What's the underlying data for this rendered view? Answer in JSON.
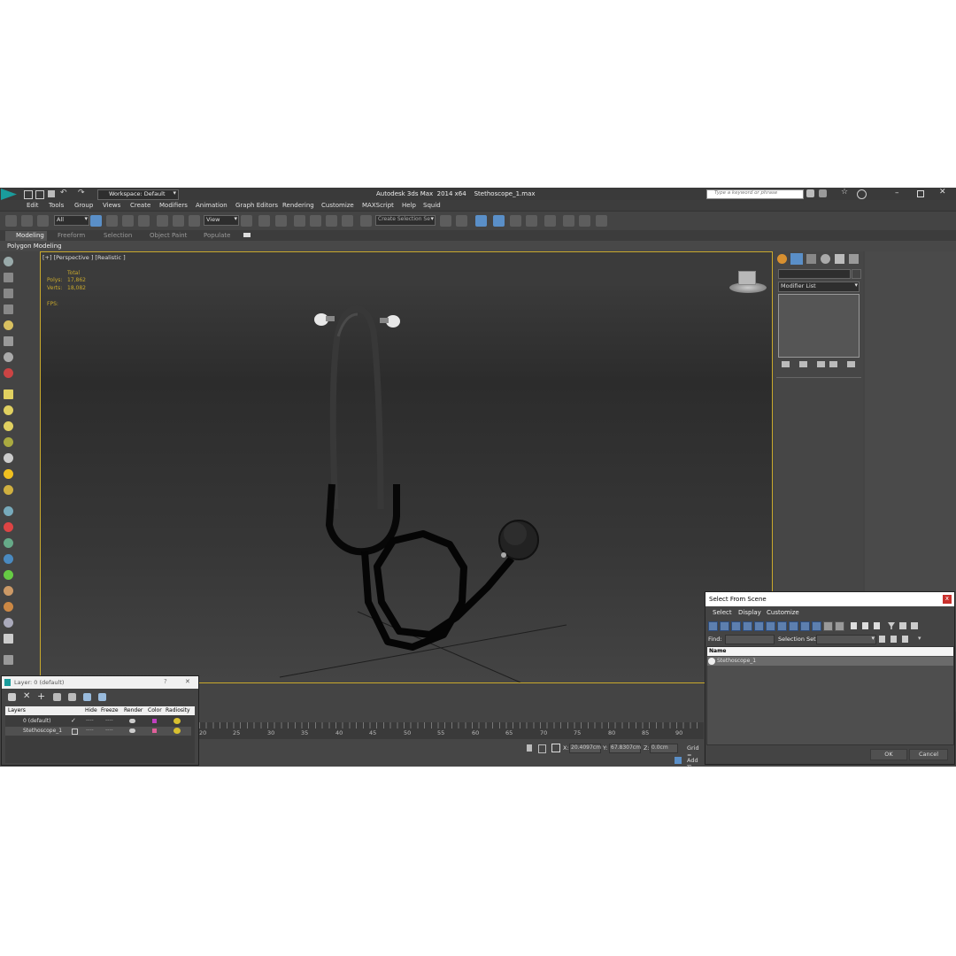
{
  "window": {
    "title": "Autodesk 3ds Max  2014 x64    Stethoscope_1.max",
    "workspace": "Workspace: Default",
    "search_placeholder": "Type a keyword or phrase"
  },
  "menu": [
    "Edit",
    "Tools",
    "Group",
    "Views",
    "Create",
    "Modifiers",
    "Animation",
    "Graph Editors",
    "Rendering",
    "Customize",
    "MAXScript",
    "Help",
    "Squid"
  ],
  "toolbar": {
    "filter_value": "All",
    "ref_coord_value": "View",
    "selection_set_placeholder": "Create Selection Se"
  },
  "ribbon": {
    "tabs": [
      "Modeling",
      "Freeform",
      "Selection",
      "Object Paint",
      "Populate"
    ],
    "sub_label": "Polygon Modeling"
  },
  "viewport": {
    "label": "[+] [Perspective ] [Realistic ]",
    "stats_total": "Total",
    "polys_label": "Polys:",
    "polys_value": "17,862",
    "verts_label": "Verts:",
    "verts_value": "18,082",
    "fps_label": "FPS:"
  },
  "command_panel": {
    "modifier_list": "Modifier List"
  },
  "timeline": {
    "ticks": [
      "20",
      "25",
      "30",
      "35",
      "40",
      "45",
      "50",
      "55",
      "60",
      "65",
      "70",
      "75",
      "80",
      "85",
      "90"
    ]
  },
  "status": {
    "x_label": "X:",
    "x_value": "20.4097cm",
    "y_label": "Y:",
    "y_value": "67.8307cm",
    "z_label": "Z:",
    "z_value": "0.0cm",
    "grid_label": "Grid =",
    "add_time_tag": "Add Ti"
  },
  "layer_dialog": {
    "title": "Layer: 0 (default)",
    "help": "?",
    "close": "✕",
    "columns": [
      "Layers",
      "Hide",
      "Freeze",
      "Render",
      "Color",
      "Radiosity"
    ],
    "rows": [
      {
        "name": "0 (default)",
        "hide": "----",
        "freeze": "----",
        "color": "#c040c0"
      },
      {
        "name": "Stethoscope_1",
        "hide": "----",
        "freeze": "----",
        "color": "#e0609a"
      }
    ]
  },
  "select_dialog": {
    "title": "Select From Scene",
    "close": "x",
    "menu": [
      "Select",
      "Display",
      "Customize"
    ],
    "find_label": "Find:",
    "selection_set_label": "Selection Set:",
    "column_name": "Name",
    "items": [
      "Stethoscope_1"
    ],
    "ok": "OK",
    "cancel": "Cancel"
  },
  "colors": {
    "app_bg": "#444444",
    "viewport_border": "#c9a92c",
    "stats_text": "#c9a92c",
    "highlight_blue": "#5a8fc8"
  }
}
